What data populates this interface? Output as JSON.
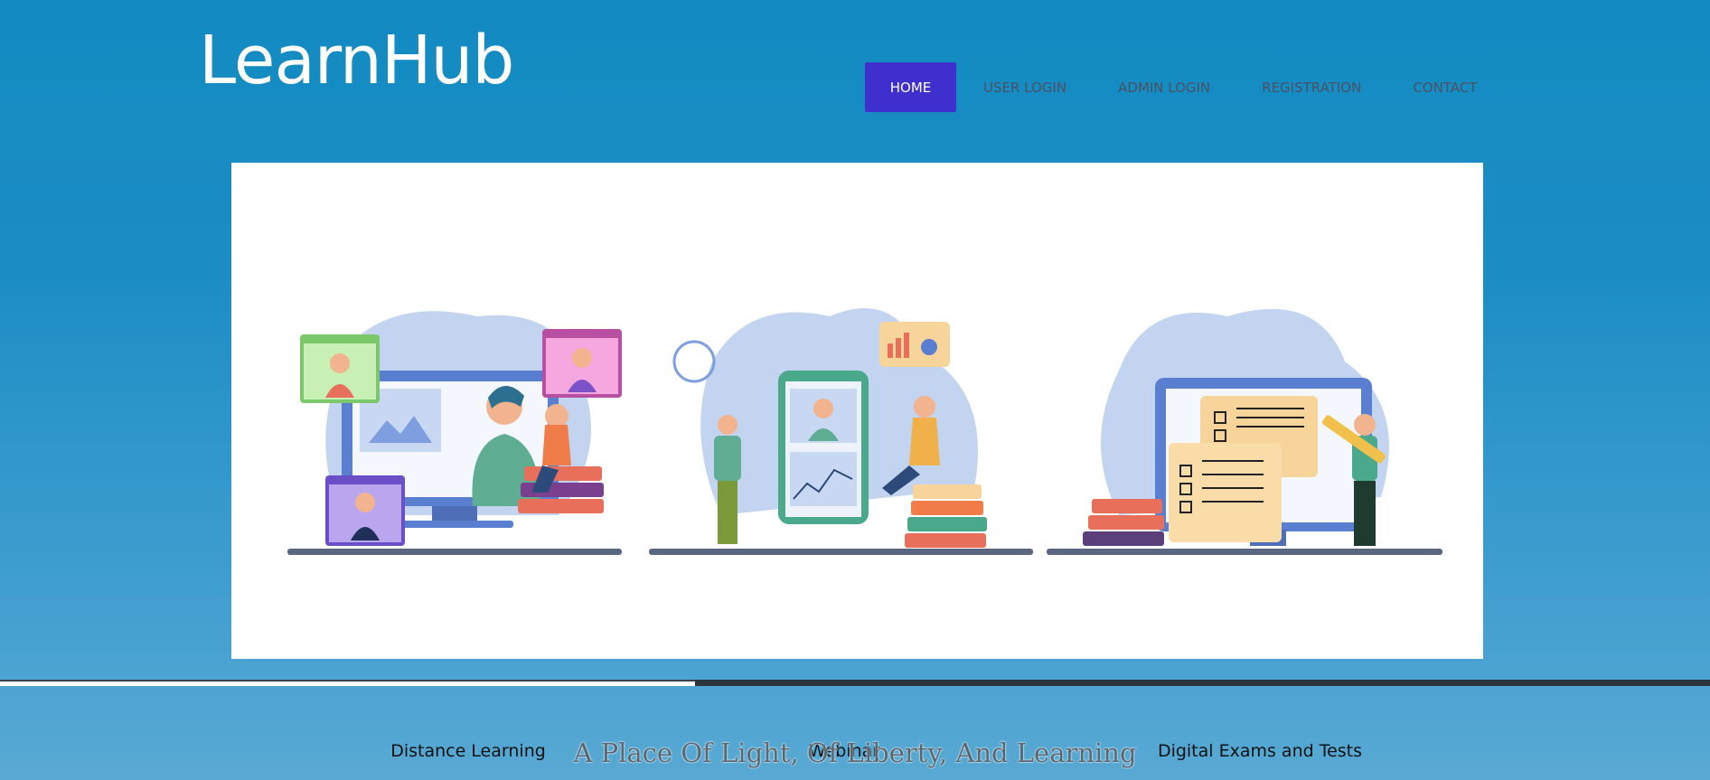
{
  "brand": {
    "logo_text": "LearnHub"
  },
  "nav": {
    "items": [
      {
        "label": "HOME",
        "active": true
      },
      {
        "label": "USER LOGIN",
        "active": false
      },
      {
        "label": "ADMIN LOGIN",
        "active": false
      },
      {
        "label": "REGISTRATION",
        "active": false
      },
      {
        "label": "CONTACT",
        "active": false
      }
    ]
  },
  "features": [
    {
      "title": "Distance Learning",
      "illustration": "distance-learning-illustration"
    },
    {
      "title": "Webinar",
      "illustration": "webinar-illustration"
    },
    {
      "title": "Digital Exams and Tests",
      "illustration": "digital-exams-illustration"
    }
  ],
  "tagline": "A Place Of Light, Of Liberty, And Learning",
  "colors": {
    "header_bg": "#128bc2",
    "nav_active_bg": "#3f2fcf",
    "panel_bg": "#ffffff",
    "illustration_blob": "#c2d4ef",
    "illustration_blue": "#5b7fd0",
    "illustration_book_red": "#e86f5a",
    "illustration_paper": "#f6d49a"
  }
}
